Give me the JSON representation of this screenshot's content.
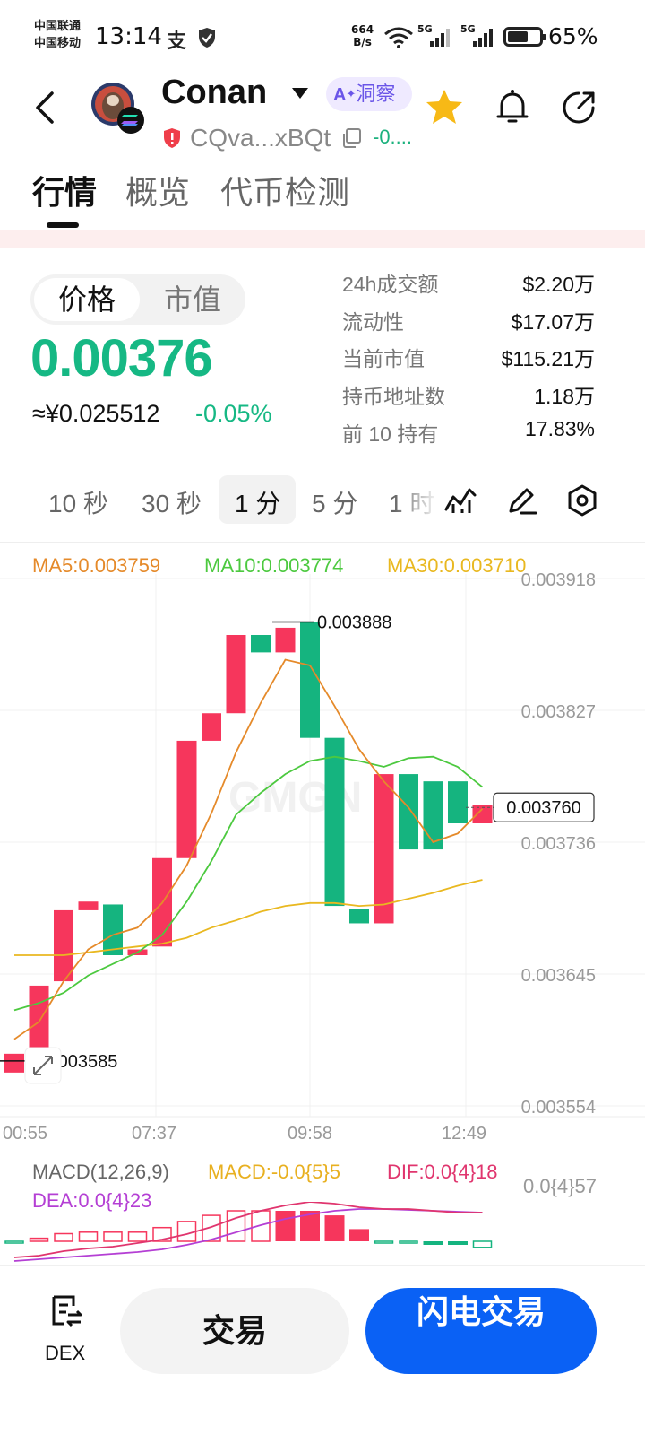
{
  "status_bar": {
    "carrier_1": "中国联通",
    "carrier_2": "中国移动",
    "time": "13:14",
    "net_speed_value": "664",
    "net_speed_unit": "B/s",
    "sig1_label": "5G",
    "sig2_label": "5G",
    "battery": "65%",
    "battery_level": 0.65,
    "icons": [
      "alipay-icon",
      "shield-check-icon",
      "wifi-icon",
      "signal-icon",
      "battery-icon"
    ]
  },
  "header": {
    "title": "Conan",
    "ai_badge": "洞察",
    "ai_prefix": "A",
    "address": "CQva...xBQt",
    "change_short": "-0...."
  },
  "tabs": [
    {
      "label": "行情",
      "active": true
    },
    {
      "label": "概览",
      "active": false
    },
    {
      "label": "代币检测",
      "active": false
    }
  ],
  "price": {
    "toggle_on": "价格",
    "toggle_off": "市值",
    "value": "0.00376",
    "cny": "≈¥0.025512",
    "change": "-0.05%"
  },
  "stats": [
    {
      "label": "24h成交额",
      "value": "$2.20万"
    },
    {
      "label": "流动性",
      "value": "$17.07万"
    },
    {
      "label": "当前市值",
      "value": "$115.21万"
    },
    {
      "label": "持币地址数",
      "value": "1.18万"
    },
    {
      "label": "前 10 持有",
      "value": "17.83%"
    }
  ],
  "intervals": [
    {
      "label": "10 秒",
      "active": false
    },
    {
      "label": "30 秒",
      "active": false
    },
    {
      "label": "1 分",
      "active": true
    },
    {
      "label": "5 分",
      "active": false
    },
    {
      "label": "1 时",
      "active": false
    }
  ],
  "chart_data": {
    "type": "candlestick",
    "ma_labels": [
      {
        "text": "MA5:0.003759",
        "color": "#e58a2a"
      },
      {
        "text": "MA10:0.003774",
        "color": "#4cc93f"
      },
      {
        "text": "MA30:0.003710",
        "color": "#e9b820"
      }
    ],
    "y_ticks": [
      "0.003918",
      "0.003827",
      "0.003736",
      "0.003645",
      "0.003554"
    ],
    "y_tick_values": [
      0.003918,
      0.003827,
      0.003736,
      0.003645,
      0.003554
    ],
    "x_ticks": [
      "00:55",
      "07:37",
      "09:58",
      "12:49"
    ],
    "high_label": "0.003888",
    "low_label": "0.003585",
    "last_price_label": "0.003760",
    "candles": [
      {
        "open": 0.00359,
        "close": 0.003577,
        "up": true
      },
      {
        "open": 0.003585,
        "close": 0.003637,
        "up": true
      },
      {
        "open": 0.00364,
        "close": 0.003689,
        "up": true
      },
      {
        "open": 0.003689,
        "close": 0.003695,
        "up": true
      },
      {
        "open": 0.003693,
        "close": 0.003658,
        "up": false
      },
      {
        "open": 0.003658,
        "close": 0.003662,
        "up": true
      },
      {
        "open": 0.003664,
        "close": 0.003725,
        "up": true
      },
      {
        "open": 0.003725,
        "close": 0.003806,
        "up": true
      },
      {
        "open": 0.003806,
        "close": 0.003825,
        "up": true
      },
      {
        "open": 0.003825,
        "close": 0.003879,
        "up": true
      },
      {
        "open": 0.003879,
        "close": 0.003867,
        "up": false
      },
      {
        "open": 0.003867,
        "close": 0.003884,
        "up": true
      },
      {
        "open": 0.003888,
        "close": 0.003808,
        "up": false
      },
      {
        "open": 0.003808,
        "close": 0.003692,
        "up": false
      },
      {
        "open": 0.00369,
        "close": 0.00368,
        "up": false
      },
      {
        "open": 0.00368,
        "close": 0.003783,
        "up": true
      },
      {
        "open": 0.003783,
        "close": 0.003731,
        "up": false
      },
      {
        "open": 0.003778,
        "close": 0.003731,
        "up": false
      },
      {
        "open": 0.003778,
        "close": 0.003749,
        "up": false
      },
      {
        "open": 0.003749,
        "close": 0.003762,
        "up": true
      }
    ],
    "ma5": [
      0.0036,
      0.003612,
      0.00364,
      0.003662,
      0.003672,
      0.003677,
      0.003694,
      0.00372,
      0.003756,
      0.003798,
      0.003832,
      0.003862,
      0.003858,
      0.00383,
      0.0038,
      0.003778,
      0.00376,
      0.003736,
      0.003742,
      0.003759
    ],
    "ma10": [
      0.00362,
      0.003625,
      0.003632,
      0.003644,
      0.003652,
      0.00366,
      0.003672,
      0.003695,
      0.003723,
      0.003755,
      0.00377,
      0.003783,
      0.003792,
      0.003795,
      0.003792,
      0.003788,
      0.003794,
      0.003795,
      0.003788,
      0.003774
    ],
    "ma30": [
      0.003658,
      0.003658,
      0.003658,
      0.00366,
      0.003662,
      0.003664,
      0.003666,
      0.00367,
      0.003677,
      0.003682,
      0.003688,
      0.003692,
      0.003694,
      0.003694,
      0.003692,
      0.003693,
      0.003697,
      0.003701,
      0.003706,
      0.00371
    ],
    "macd": {
      "label": "MACD(12,26,9)",
      "macd_label": "MACD:-0.0{5}5",
      "dif_label": "DIF:0.0{4}18",
      "dea_label": "DEA:0.0{4}23",
      "axis_label": "0.0{4}57",
      "histogram": [
        -0.05,
        0.1,
        0.25,
        0.3,
        0.3,
        0.3,
        0.45,
        0.65,
        0.85,
        1.0,
        1.0,
        1.0,
        1.0,
        0.85,
        0.4,
        -0.05,
        -0.05,
        -0.2,
        -0.2,
        -0.2
      ]
    }
  },
  "bottom": {
    "dex_label": "DEX",
    "trade_label": "交易",
    "flash_label": "闪电交易"
  },
  "colors": {
    "up": "#f6365c",
    "down": "#15b47f",
    "brand_blue": "#0a61f5",
    "price_green": "#16b884"
  }
}
